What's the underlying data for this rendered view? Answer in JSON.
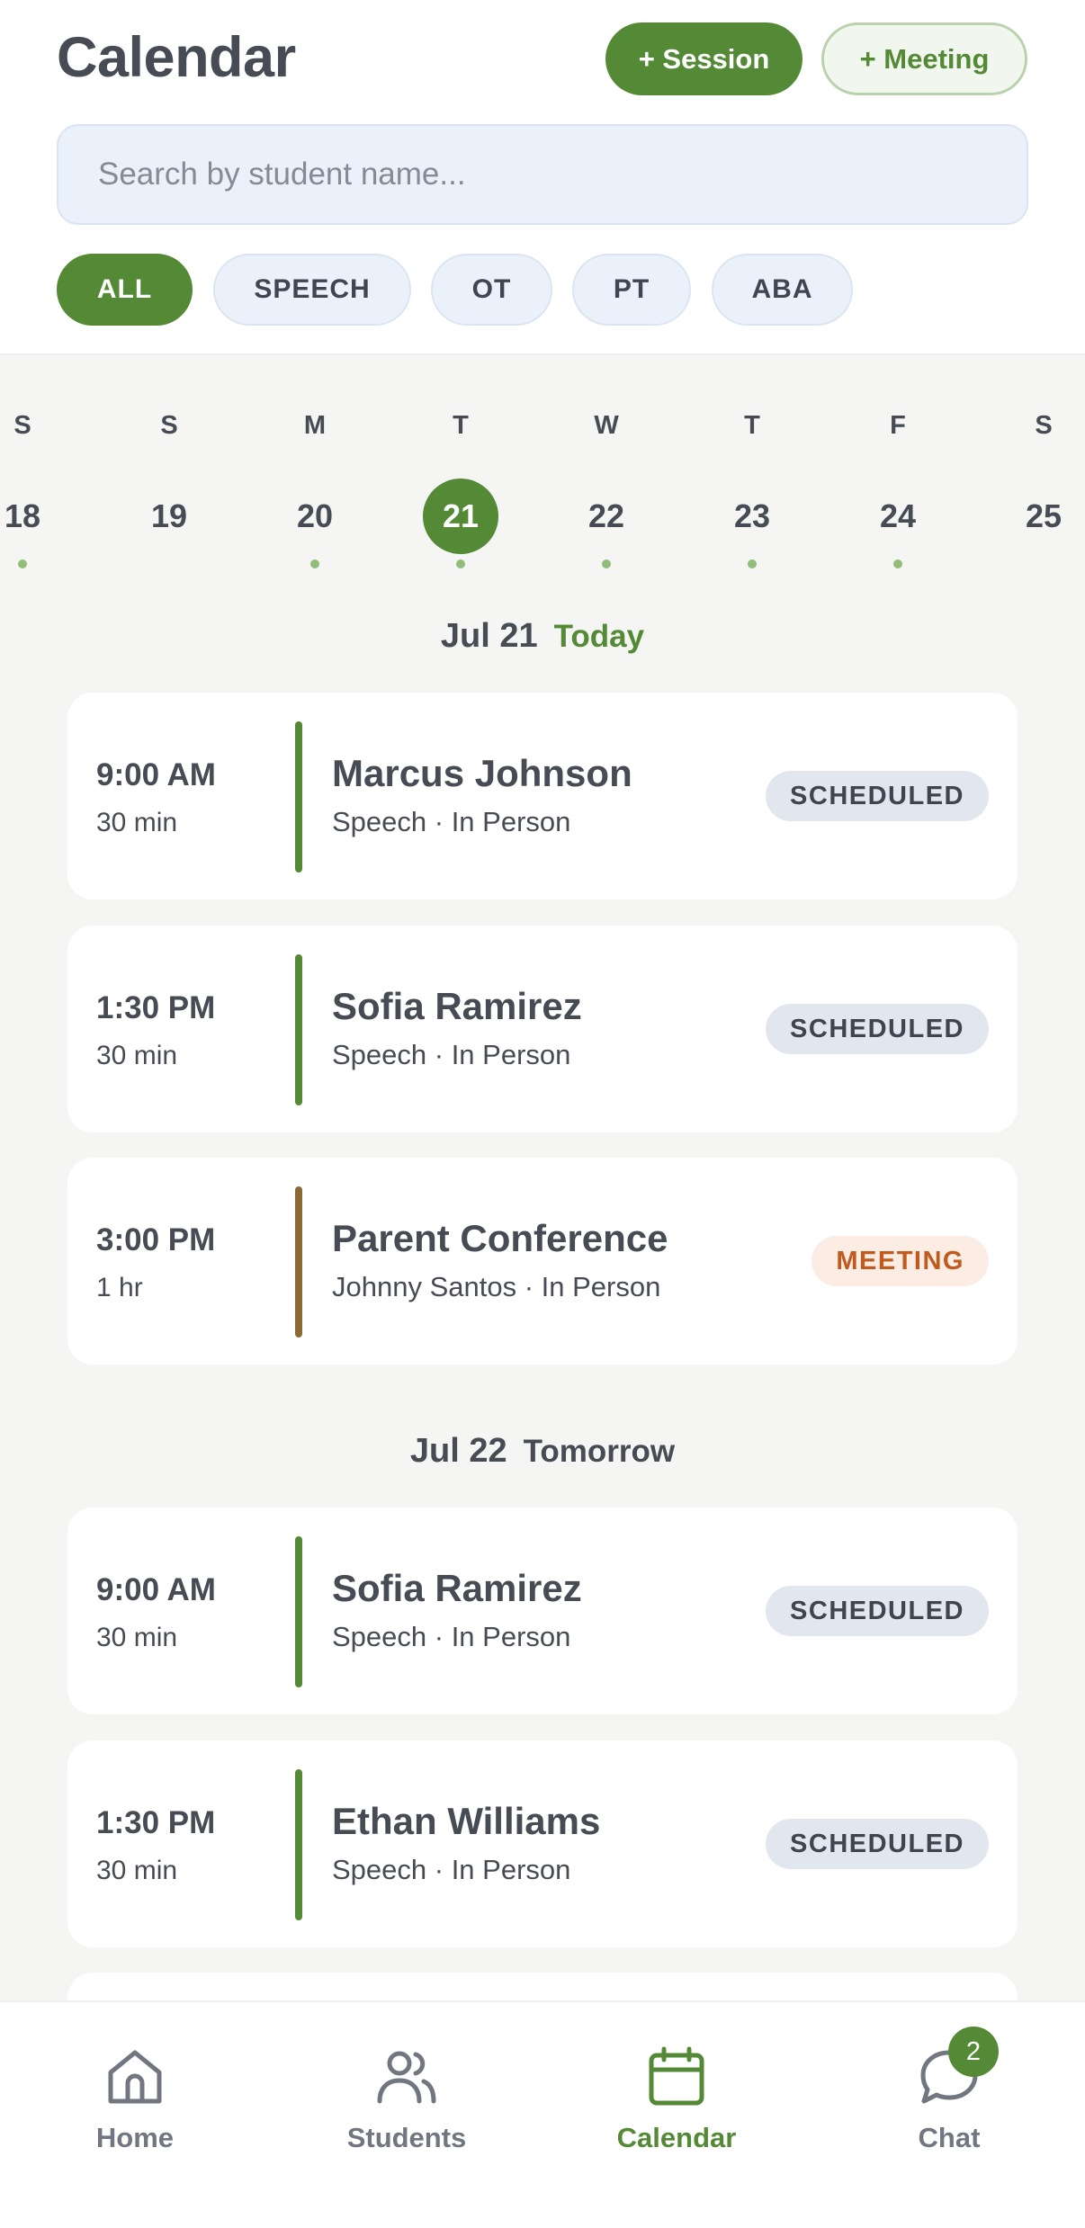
{
  "header": {
    "title": "Calendar",
    "add_session_label": "+ Session",
    "add_meeting_label": "+ Meeting"
  },
  "search": {
    "placeholder": "Search by student name..."
  },
  "filters": [
    "ALL",
    "SPEECH",
    "OT",
    "PT",
    "ABA"
  ],
  "active_filter": "ALL",
  "week": [
    {
      "letter": "S",
      "num": "18",
      "has_events": true
    },
    {
      "letter": "S",
      "num": "19",
      "has_events": false
    },
    {
      "letter": "M",
      "num": "20",
      "has_events": true
    },
    {
      "letter": "T",
      "num": "21",
      "has_events": true,
      "selected": true
    },
    {
      "letter": "W",
      "num": "22",
      "has_events": true
    },
    {
      "letter": "T",
      "num": "23",
      "has_events": true
    },
    {
      "letter": "F",
      "num": "24",
      "has_events": true
    },
    {
      "letter": "S",
      "num": "25",
      "has_events": false
    }
  ],
  "groups": [
    {
      "date": "Jul 21",
      "relative": "Today",
      "events": [
        {
          "time": "9:00 AM",
          "duration": "30 min",
          "title": "Marcus Johnson",
          "subtitle": "Speech · In Person",
          "status": "SCHEDULED"
        },
        {
          "time": "1:30 PM",
          "duration": "30 min",
          "title": "Sofia Ramirez",
          "subtitle": "Speech · In Person",
          "status": "SCHEDULED"
        },
        {
          "time": "3:00 PM",
          "duration": "1 hr",
          "title": "Parent Conference",
          "subtitle": "Johnny Santos · In Person",
          "status": "MEETING"
        }
      ]
    },
    {
      "date": "Jul 22",
      "relative": "Tomorrow",
      "events": [
        {
          "time": "9:00 AM",
          "duration": "30 min",
          "title": "Sofia Ramirez",
          "subtitle": "Speech · In Person",
          "status": "SCHEDULED"
        },
        {
          "time": "1:30 PM",
          "duration": "30 min",
          "title": "Ethan Williams",
          "subtitle": "Speech · In Person",
          "status": "SCHEDULED"
        }
      ]
    }
  ],
  "tabs": [
    {
      "label": "Home",
      "icon": "home-icon"
    },
    {
      "label": "Students",
      "icon": "users-icon"
    },
    {
      "label": "Calendar",
      "icon": "calendar-icon",
      "active": true
    },
    {
      "label": "Chat",
      "icon": "chat-icon",
      "badge": "2"
    }
  ],
  "colors": {
    "accent": "#548a35",
    "meeting_bar": "#8b6a34",
    "meeting_text": "#c05a1e"
  }
}
